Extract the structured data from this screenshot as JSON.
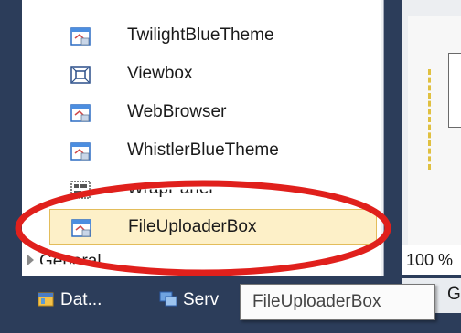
{
  "toolbox": {
    "items": [
      {
        "label": "TwilightBlueTheme",
        "icon": "theme-control-icon"
      },
      {
        "label": "Viewbox",
        "icon": "viewbox-icon"
      },
      {
        "label": "WebBrowser",
        "icon": "theme-control-icon"
      },
      {
        "label": "WhistlerBlueTheme",
        "icon": "theme-control-icon"
      },
      {
        "label": "WrapPanel",
        "icon": "wrappanel-icon"
      },
      {
        "label": "FileUploaderBox",
        "icon": "theme-control-icon",
        "selected": true
      }
    ],
    "group_label": "General"
  },
  "bottom_tabs": [
    {
      "label": "Dat...",
      "icon": "data-sources-icon"
    },
    {
      "label": "Serv",
      "icon": "server-explorer-icon"
    }
  ],
  "designer": {
    "zoom_label": "100 %",
    "tab_label": "G"
  },
  "tooltip": {
    "text": "FileUploaderBox"
  },
  "annotation": {
    "highlight_color": "#e0201c"
  }
}
